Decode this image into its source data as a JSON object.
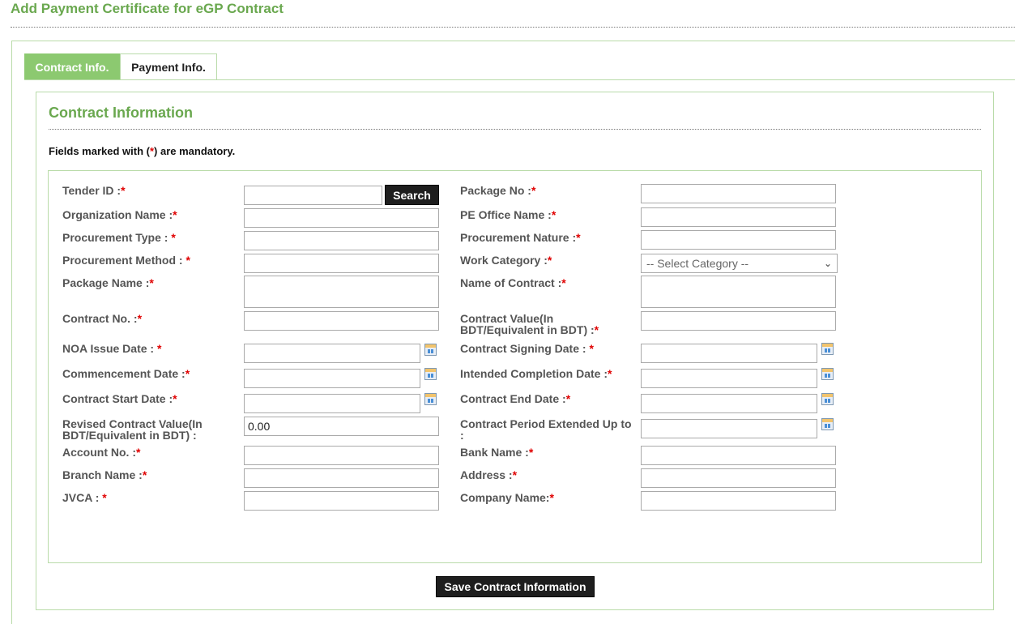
{
  "page": {
    "title": "Add Payment Certificate for eGP Contract"
  },
  "tabs": [
    {
      "label": "Contract Info.",
      "active": true
    },
    {
      "label": "Payment Info.",
      "active": false
    }
  ],
  "section": {
    "title": "Contract Information",
    "mandatory_prefix": "Fields marked with (",
    "mandatory_star": "*",
    "mandatory_suffix": ") are mandatory."
  },
  "form": {
    "tender_id": {
      "label": "Tender ID :",
      "value": ""
    },
    "search_button": "Search",
    "package_no": {
      "label": "Package No :",
      "value": ""
    },
    "organization_name": {
      "label": "Organization Name :",
      "value": ""
    },
    "pe_office_name": {
      "label": "PE Office Name :",
      "value": ""
    },
    "procurement_type": {
      "label": "Procurement Type : ",
      "value": ""
    },
    "procurement_nature": {
      "label": "Procurement Nature :",
      "value": ""
    },
    "procurement_method": {
      "label": "Procurement Method : ",
      "value": ""
    },
    "work_category": {
      "label": "Work Category :",
      "selected": "-- Select Category --"
    },
    "package_name": {
      "label": "Package Name :",
      "value": ""
    },
    "name_of_contract": {
      "label": "Name of Contract :",
      "value": ""
    },
    "contract_no": {
      "label": "Contract No. :",
      "value": ""
    },
    "contract_value": {
      "label": "Contract Value(In BDT/Equivalent in BDT) :",
      "value": ""
    },
    "noa_issue_date": {
      "label": "NOA Issue Date : ",
      "value": ""
    },
    "contract_signing_date": {
      "label": "Contract Signing Date : ",
      "value": ""
    },
    "commencement_date": {
      "label": "Commencement Date :",
      "value": ""
    },
    "intended_completion_date": {
      "label": "Intended Completion Date :",
      "value": ""
    },
    "contract_start_date": {
      "label": "Contract Start Date :",
      "value": ""
    },
    "contract_end_date": {
      "label": "Contract End Date :",
      "value": ""
    },
    "revised_contract_value": {
      "label": "Revised Contract Value(In BDT/Equivalent in BDT) :",
      "value": "0.00"
    },
    "contract_period_extended": {
      "label": "Contract Period Extended Up to :",
      "value": ""
    },
    "account_no": {
      "label": "Account No. :",
      "value": ""
    },
    "bank_name": {
      "label": "Bank Name :",
      "value": ""
    },
    "branch_name": {
      "label": "Branch Name :",
      "value": ""
    },
    "address": {
      "label": "Address :",
      "value": ""
    },
    "jvca": {
      "label": "JVCA : ",
      "value": ""
    },
    "company_name": {
      "label": "Company Name:",
      "value": ""
    },
    "required_mark": "*"
  },
  "save_button": "Save Contract Information",
  "colors": {
    "accent_green": "#6aa84f",
    "tab_active": "#8cc970",
    "border_green": "#b9dba9",
    "required_red": "#e00000"
  },
  "icons": {
    "calendar": "calendar-icon",
    "dropdown": "chevron-down-icon"
  }
}
